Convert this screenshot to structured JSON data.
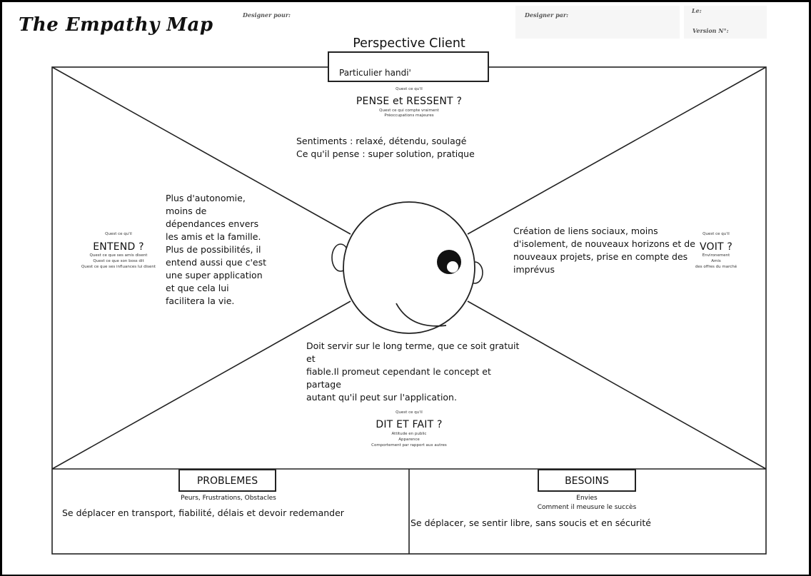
{
  "header": {
    "title": "The Empathy Map",
    "designer_for": "Designer pour:",
    "designer_by": "Designer par:",
    "date": "Le:",
    "version": "Version N°:"
  },
  "perspective": {
    "title": "Perspective Client",
    "client": "Particulier handi'"
  },
  "top": {
    "small1": "Quest ce qu'il",
    "heading": "PENSE et RESSENT ?",
    "small2": "Quest ce qui compte vraiment",
    "small3": "Préoccupations majeures",
    "line1": "Sentiments : relaxé, détendu, soulagé",
    "line2": "Ce qu'il pense : super solution, pratique"
  },
  "left": {
    "small1": "Quest ce qu'il",
    "heading": "ENTEND ?",
    "small2": "Quest ce que ses amis disent",
    "small3": "Quest ce que son boss dit",
    "small4": "Quest ce que ses influances lui disent",
    "lines": [
      "Plus d'autonomie,",
      "moins de",
      "dépendances envers",
      "les amis et la famille.",
      "Plus de possibilités, il",
      "entend aussi que c'est",
      "une super application",
      "et que cela lui",
      "facilitera la vie."
    ]
  },
  "right": {
    "small1": "Quest ce qu'il",
    "heading": "VOIT ?",
    "small2": "Environement",
    "small3": "Amis",
    "small4": "des offres du marché",
    "lines": [
      "Création de liens sociaux, moins",
      "d'isolement, de nouveaux horizons et de",
      "nouveaux projets, prise en compte des",
      "imprévus"
    ]
  },
  "bottom": {
    "lines": [
      "Doit servir sur le long terme, que ce soit gratuit et",
      "fiable.Il promeut cependant le concept et partage",
      "autant qu'il peut sur l'application."
    ],
    "small1": "Quest ce qu'il",
    "heading": "DIT ET FAIT ?",
    "small2": "Attitude en public",
    "small3": "Apparence",
    "small4": "Comportement par rapport aux autres"
  },
  "problems": {
    "label": "PROBLEMES",
    "sub": "Peurs, Frustrations, Obstacles",
    "text": "Se déplacer en transport, fiabilité, délais et devoir redemander"
  },
  "needs": {
    "label": "BESOINS",
    "sub1": "Envies",
    "sub2": "Comment il meusure le succès",
    "text": "Se déplacer, se sentir libre, sans soucis et en sécurité"
  }
}
